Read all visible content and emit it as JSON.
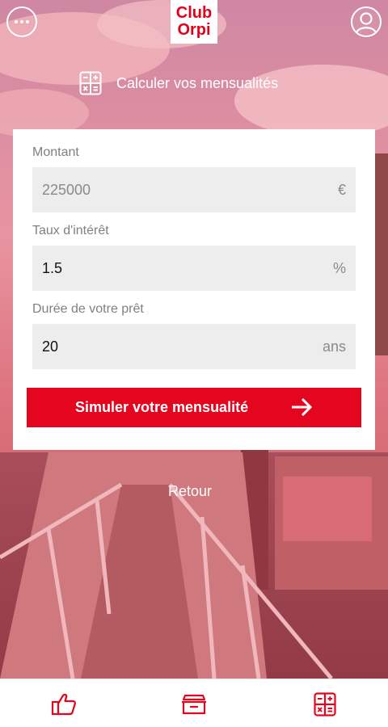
{
  "header": {
    "logo_line1": "Club",
    "logo_line2": "Orpi",
    "menu_icon": "more-dots-icon",
    "profile_icon": "user-profile-icon"
  },
  "title": {
    "icon": "calculator-icon",
    "text": "Calculer vos mensualités"
  },
  "form": {
    "amount": {
      "label": "Montant",
      "value": "225000",
      "unit": "€"
    },
    "rate": {
      "label": "Taux d'intérêt",
      "value": "1.5",
      "unit": "%"
    },
    "duration": {
      "label": "Durée de votre prêt",
      "value": "20",
      "unit": "ans"
    },
    "submit_label": "Simuler votre mensualité"
  },
  "back_label": "Retour",
  "bottom_nav": {
    "items": [
      {
        "icon": "thumbs-up-icon"
      },
      {
        "icon": "open-box-icon"
      },
      {
        "icon": "calculator-icon"
      }
    ]
  },
  "colors": {
    "brand_red": "#e3061e",
    "overlay_pink": "#f07a8a"
  }
}
